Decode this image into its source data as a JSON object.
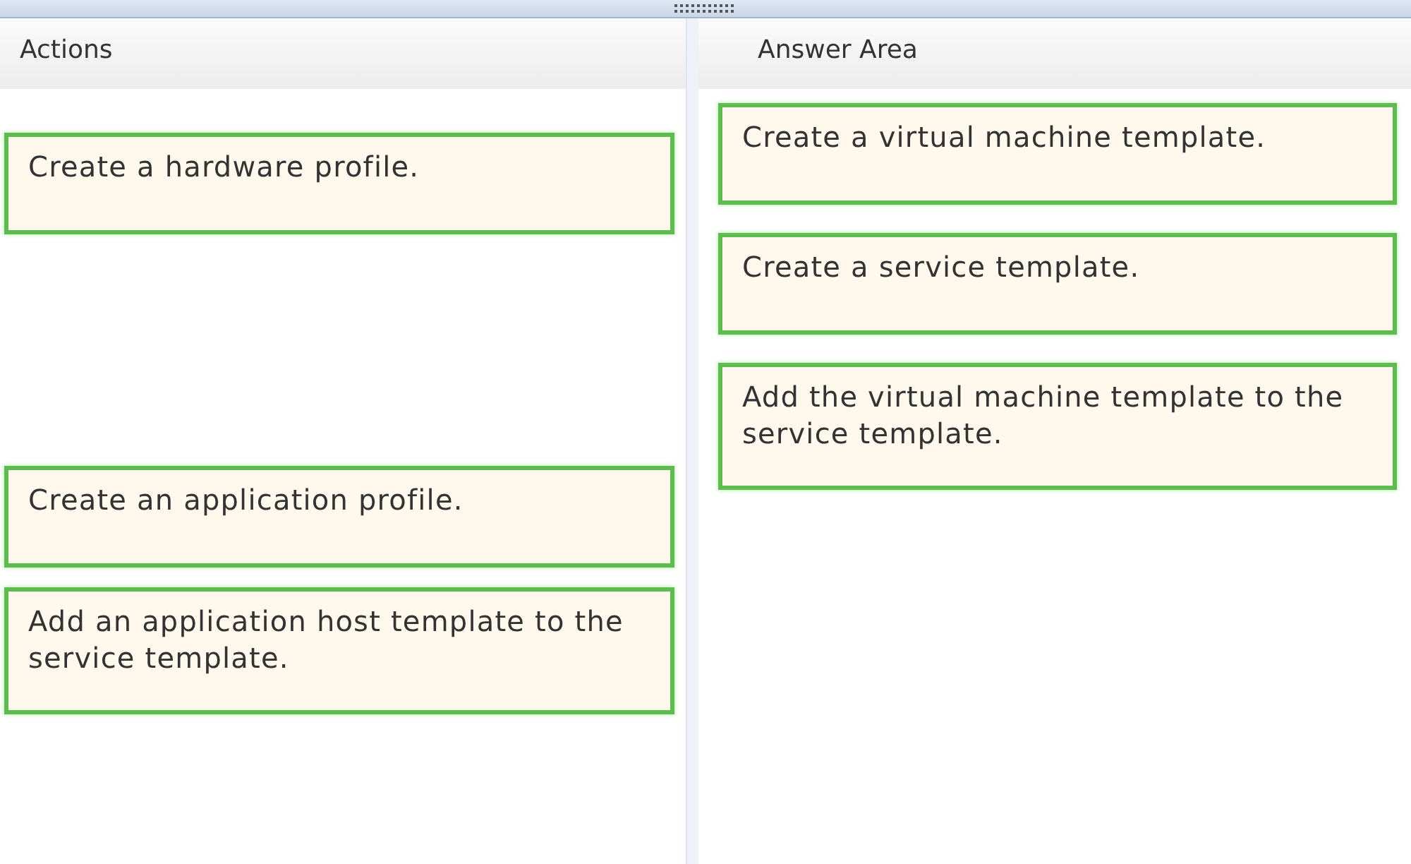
{
  "actions": {
    "title": "Actions",
    "items": [
      {
        "text": "Create a hardware profile."
      },
      {
        "text": "Create an application profile."
      },
      {
        "text": "Add an application host template to the service template."
      }
    ]
  },
  "answer_area": {
    "title": "Answer Area",
    "items": [
      {
        "text": "Create a virtual machine template."
      },
      {
        "text": "Create a service template."
      },
      {
        "text": "Add the virtual machine template to the service template."
      }
    ]
  }
}
